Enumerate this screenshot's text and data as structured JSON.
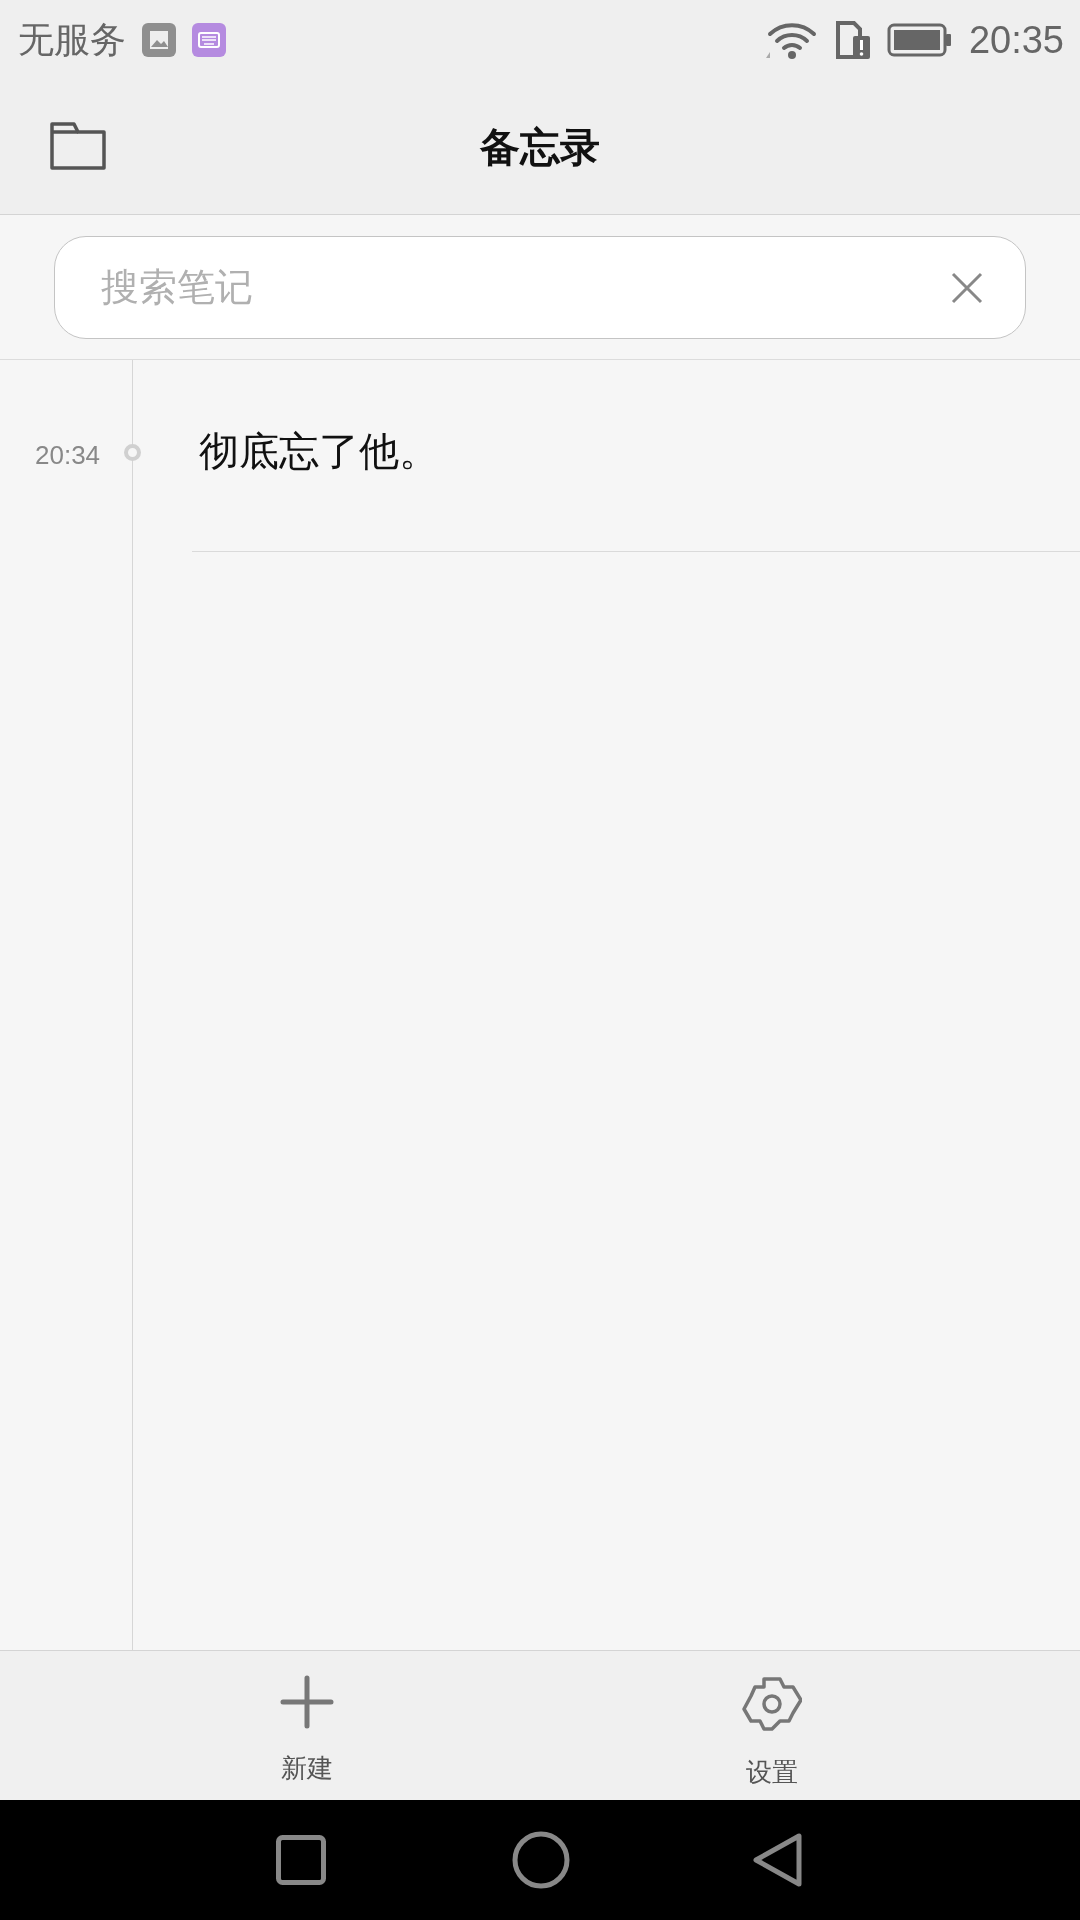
{
  "status_bar": {
    "carrier": "无服务",
    "time": "20:35"
  },
  "header": {
    "title": "备忘录"
  },
  "search": {
    "placeholder": "搜索笔记"
  },
  "notes": [
    {
      "time": "20:34",
      "text": "彻底忘了他。"
    }
  ],
  "toolbar": [
    {
      "kind": "new",
      "label": "新建"
    },
    {
      "kind": "settings",
      "label": "设置"
    }
  ]
}
